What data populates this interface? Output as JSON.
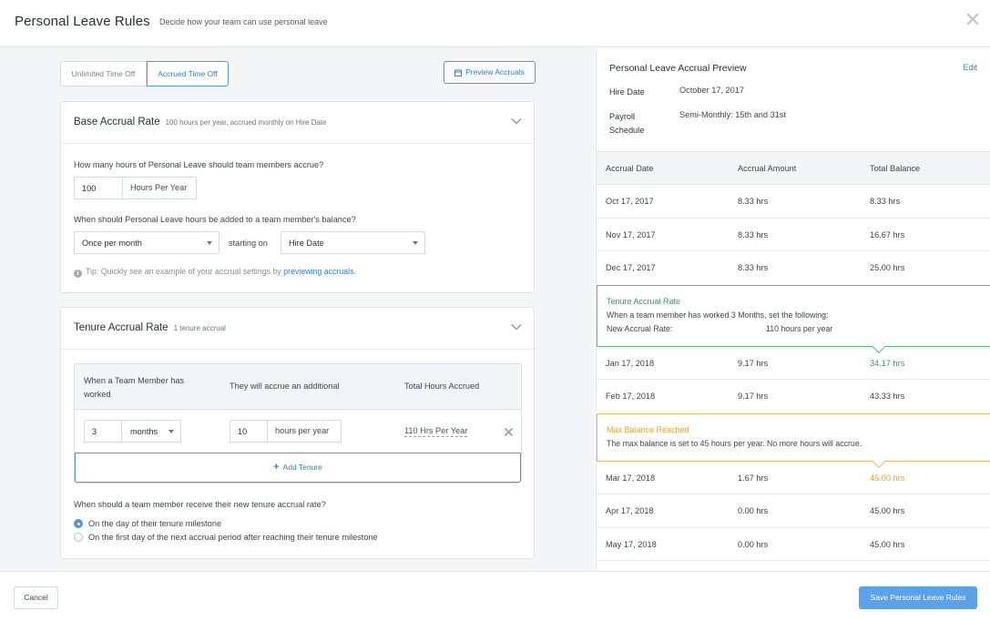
{
  "header": {
    "title": "Personal Leave Rules",
    "subtitle": "Decide how your team can use personal leave"
  },
  "tabs": {
    "unlimited": "Unlimited Time Off",
    "accrued": "Accrued Time Off"
  },
  "preview_button": "Preview Accruals",
  "base_accrual": {
    "title": "Base Accrual Rate",
    "summary": "100 hours per year, accrued monthly on Hire Date",
    "hours_question": "How many hours of Personal Leave should team members accrue?",
    "hours_value": "100",
    "hours_unit": "Hours Per Year",
    "when_question": "When should Personal Leave hours be added to a team member's balance?",
    "frequency_selected": "Once per month",
    "starting_on_label": "starting on",
    "start_selected": "Hire Date",
    "tip_text": "Tip: Quickly see an example of your accrual settings by",
    "tip_link": "previewing accruals",
    "tip_end": "."
  },
  "tenure_accrual": {
    "title": "Tenure Accrual Rate",
    "summary": "1 tenure accrual",
    "col_worked": "When a Team Member has worked",
    "col_additional": "They will accrue an additional",
    "col_total": "Total Hours Accrued",
    "row": {
      "duration_value": "3",
      "duration_unit": "months",
      "additional_value": "10",
      "additional_unit": "hours per year",
      "total": "110 Hrs Per Year"
    },
    "add_label": "Add Tenure",
    "when_question": "When should a team member receive their new tenure accrual rate?",
    "options": [
      {
        "label": "On the day of their tenure milestone",
        "selected": true
      },
      {
        "label": "On the first day of the next accrual period after reaching their tenure milestone",
        "selected": false
      }
    ]
  },
  "preview": {
    "title": "Personal Leave Accrual Preview",
    "edit_label": "Edit",
    "hire_date_label": "Hire Date",
    "hire_date_value": "October 17, 2017",
    "payroll_label_1": "Payroll",
    "payroll_label_2": "Schedule",
    "payroll_value": "Semi-Monthly: 15th and 31st",
    "columns": [
      "Accrual Date",
      "Accrual Amount",
      "Total Balance"
    ],
    "rows_a": [
      [
        "Oct 17, 2017",
        "8.33 hrs",
        "8.33 hrs"
      ],
      [
        "Nov 17, 2017",
        "8.33 hrs",
        "16.67 hrs"
      ],
      [
        "Dec 17, 2017",
        "8.33 hrs",
        "25.00 hrs"
      ]
    ],
    "tenure_notice": {
      "title": "Tenure Accrual Rate",
      "line1": "When a team member has worked 3 Months, set the following:",
      "line2_label": "New Accrual Rate:",
      "line2_value": "110 hours per year"
    },
    "rows_b": [
      [
        "Jan 17, 2018",
        "9.17 hrs",
        "34.17 hrs"
      ],
      [
        "Feb 17, 2018",
        "9.17 hrs",
        "43.33 hrs"
      ]
    ],
    "max_notice": {
      "title": "Max Balance Reached",
      "line1": "The max balance is set to 45 hours per year. No more hours will accrue."
    },
    "rows_c": [
      [
        "Mar 17, 2018",
        "1.67 hrs",
        "45.00 hrs"
      ],
      [
        "Apr 17, 2018",
        "0.00 hrs",
        "45.00 hrs"
      ],
      [
        "May 17, 2018",
        "0.00 hrs",
        "45.00 hrs"
      ]
    ]
  },
  "footer": {
    "cancel": "Cancel",
    "save": "Save Personal Leave Rules"
  },
  "colors": {
    "accent": "#4d97e3",
    "green": "#2aa35a",
    "orange": "#f0a030",
    "save_bg": "#5aa2ea"
  }
}
